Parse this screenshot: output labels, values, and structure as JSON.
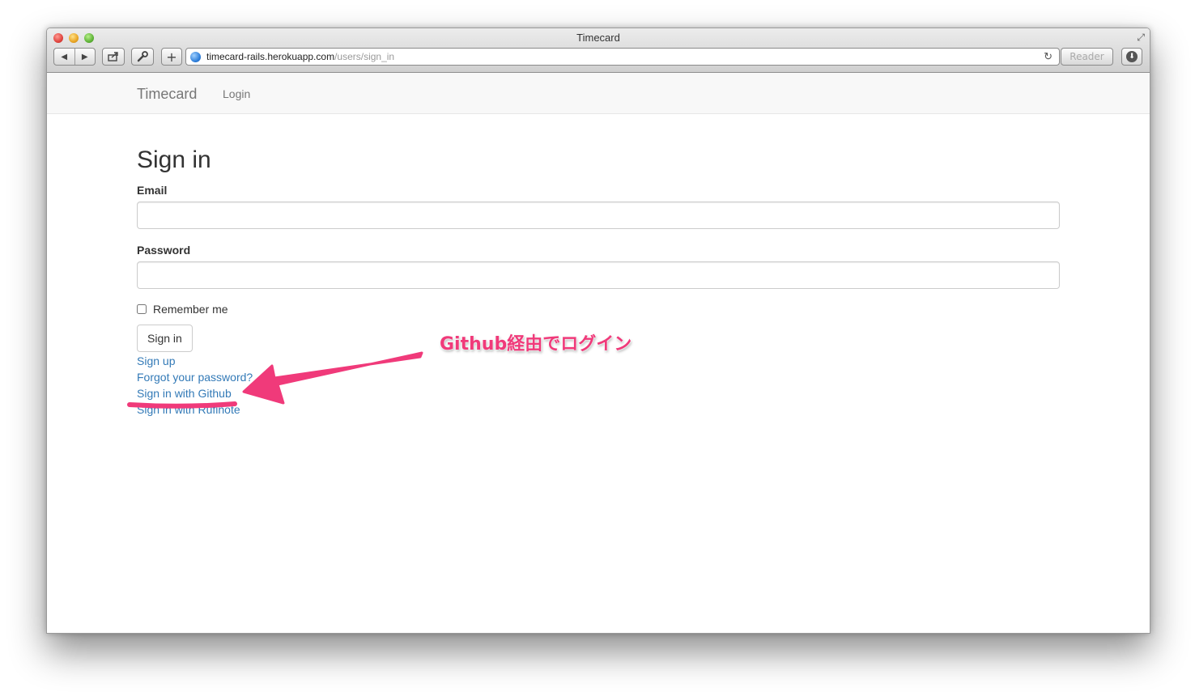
{
  "window": {
    "title": "Timecard",
    "toolbar": {
      "back_icon": "◀",
      "forward_icon": "▶",
      "new_tab": "+",
      "reader_label": "Reader"
    },
    "url": {
      "host": "timecard-rails.herokuapp.com",
      "path": "/users/sign_in"
    }
  },
  "navbar": {
    "brand": "Timecard",
    "login": "Login"
  },
  "form": {
    "title": "Sign in",
    "email_label": "Email",
    "email_value": "",
    "password_label": "Password",
    "password_value": "",
    "remember_label": "Remember me",
    "submit_label": "Sign in"
  },
  "links": [
    {
      "label": "Sign up"
    },
    {
      "label": "Forgot your password?"
    },
    {
      "label": "Sign in with Github"
    },
    {
      "label": "Sign in with Rufinote"
    }
  ],
  "annotation": {
    "text": "Github経由でログイン",
    "color": "#f03a7a"
  }
}
